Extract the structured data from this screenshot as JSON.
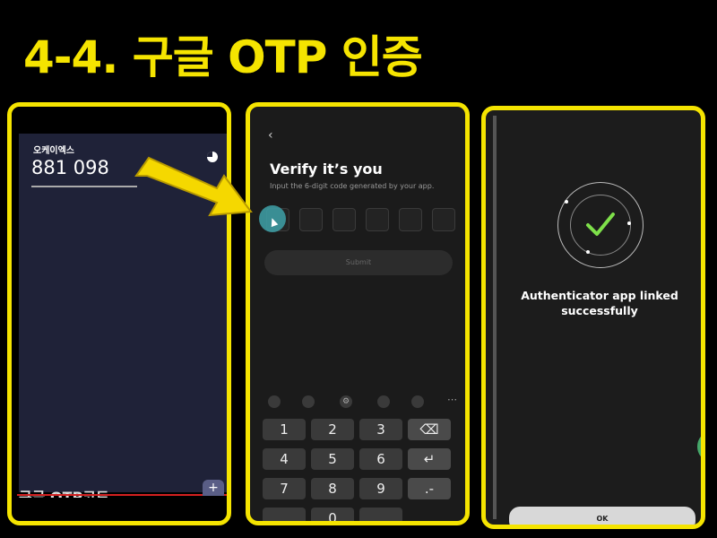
{
  "title": "4-4. 구글 OTP 인증",
  "panel1": {
    "account_name": "오케이엑스",
    "otp_code": "881 098",
    "bottom_caption": "구글 OTP코드",
    "add_button": "+"
  },
  "panel2": {
    "back": "‹",
    "heading": "Verify it’s you",
    "subtext": "Input the 6-digit code generated by your app.",
    "submit_label": "Submit",
    "toolbar_more": "⋯",
    "keys": [
      "1",
      "2",
      "3",
      "⌫",
      "4",
      "5",
      "6",
      "↵",
      "7",
      "8",
      "9",
      ".-",
      "",
      "0",
      "",
      ""
    ]
  },
  "panel3": {
    "message": "Authenticator app linked successfully",
    "ok_label": "OK"
  },
  "colors": {
    "accent_yellow": "#f5e400",
    "teal_cursor": "#3ea1a8",
    "check_green": "#7ee04a"
  }
}
